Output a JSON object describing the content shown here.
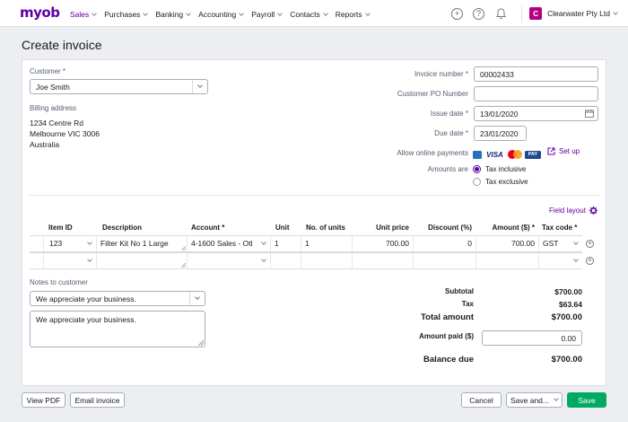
{
  "nav": {
    "logo": "myob",
    "items": [
      {
        "label": "Sales",
        "active": true
      },
      {
        "label": "Purchases",
        "active": false
      },
      {
        "label": "Banking",
        "active": false
      },
      {
        "label": "Accounting",
        "active": false
      },
      {
        "label": "Payroll",
        "active": false
      },
      {
        "label": "Contacts",
        "active": false
      },
      {
        "label": "Reports",
        "active": false
      }
    ],
    "add_icon": "+",
    "help_icon": "?",
    "avatar_letter": "C",
    "company": "Clearwater Pty Ltd",
    "accent_color": "#6100a5",
    "avatar_color": "#b40084"
  },
  "page": {
    "title": "Create invoice"
  },
  "form": {
    "customer_label": "Customer",
    "customer_value": "Joe Smith",
    "billing_label": "Billing address",
    "billing_lines": [
      "1234 Centre Rd",
      "Melbourne VIC 3006",
      "Australia"
    ],
    "invoice_number_label": "Invoice number",
    "invoice_number": "00002433",
    "po_label": "Customer PO Number",
    "po_value": "",
    "issue_date_label": "Issue date",
    "issue_date": "13/01/2020",
    "due_date_label": "Due date",
    "due_date": "23/01/2020",
    "online_payments_label": "Allow online payments",
    "payment_logos": [
      "VISA",
      "PAY"
    ],
    "setup_label": "Set up",
    "amounts_are_label": "Amounts are",
    "tax_inclusive": "Tax inclusive",
    "tax_exclusive": "Tax exclusive",
    "required_mark": "*"
  },
  "table": {
    "field_layout": "Field layout",
    "headers": {
      "item": "Item ID",
      "description": "Description",
      "account": "Account *",
      "unit": "Unit",
      "units": "No. of units",
      "price": "Unit price",
      "discount": "Discount (%)",
      "amount": "Amount ($) *",
      "taxcode": "Tax code *"
    },
    "rows": [
      {
        "item": "123",
        "description": "Filter Kit No 1 Large",
        "account": "4-1600 Sales - Otl",
        "unit": "1",
        "units": "1",
        "price": "700.00",
        "discount": "0",
        "amount": "700.00",
        "taxcode": "GST"
      },
      {
        "item": "",
        "description": "",
        "account": "",
        "unit": "",
        "units": "",
        "price": "",
        "discount": "",
        "amount": "",
        "taxcode": ""
      }
    ]
  },
  "notes": {
    "label": "Notes to customer",
    "selected": "We appreciate your business.",
    "text": "We appreciate your business."
  },
  "totals": {
    "subtotal_label": "Subtotal",
    "subtotal": "$700.00",
    "tax_label": "Tax",
    "tax": "$63.64",
    "total_label": "Total amount",
    "total": "$700.00",
    "paid_label": "Amount paid ($)",
    "paid": "0.00",
    "balance_label": "Balance due",
    "balance": "$700.00"
  },
  "footer": {
    "view_pdf": "View PDF",
    "email_invoice": "Email invoice",
    "cancel": "Cancel",
    "save_and": "Save and...",
    "save": "Save",
    "save_color": "#00aa64"
  }
}
